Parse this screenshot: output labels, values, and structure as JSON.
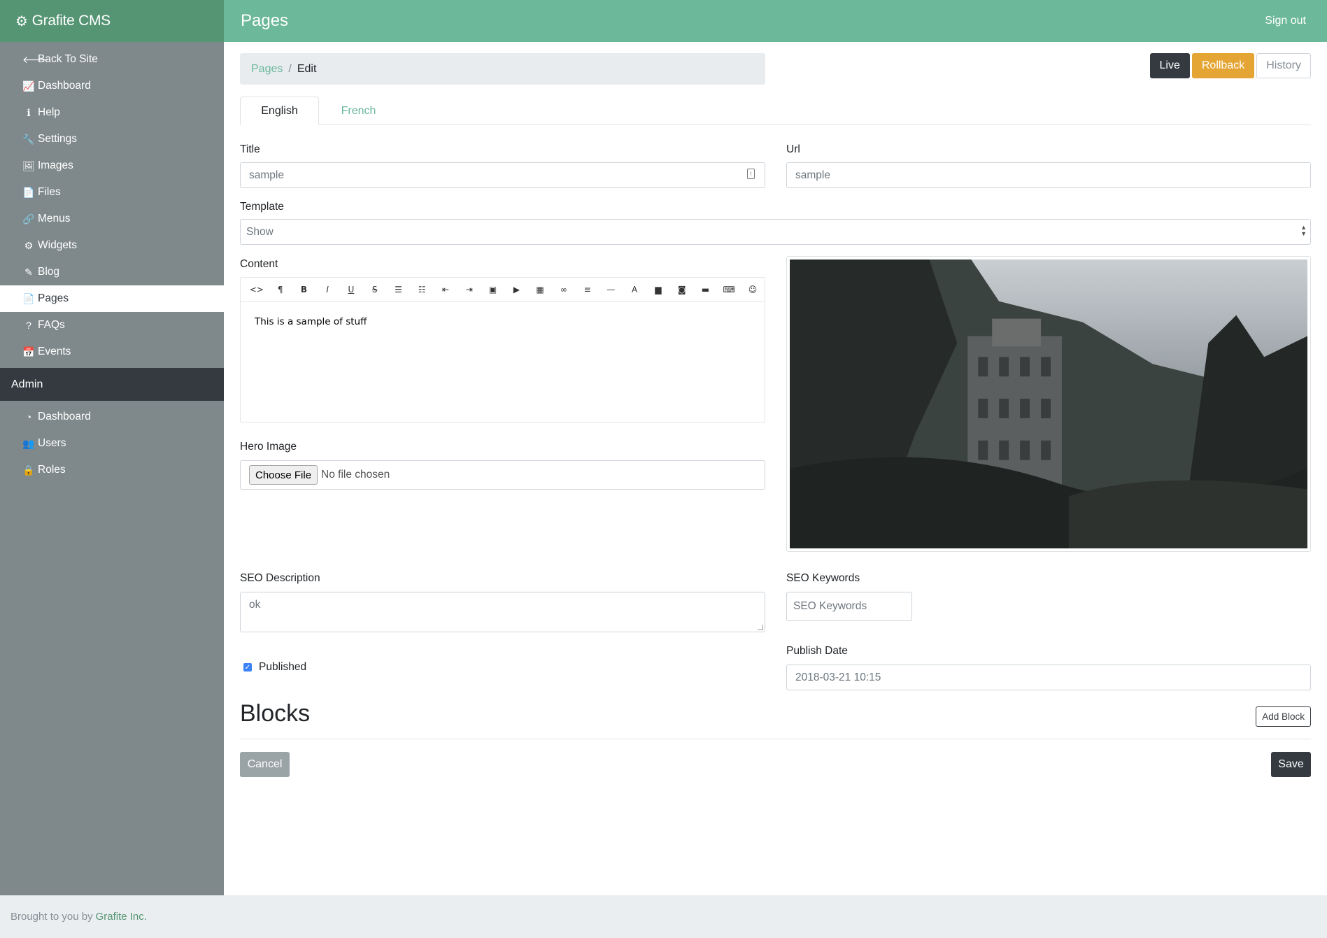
{
  "brand": {
    "name": "Grafite CMS",
    "icon": "cogs-icon"
  },
  "header": {
    "title": "Pages",
    "signout_label": "Sign out"
  },
  "sidebar": {
    "items": [
      {
        "label": "Back To Site",
        "icon": "arrow-left-icon",
        "glyph": "🡐"
      },
      {
        "label": "Dashboard",
        "icon": "line-chart-icon",
        "glyph": "📈"
      },
      {
        "label": "Help",
        "icon": "info-circle-icon",
        "glyph": "ℹ"
      },
      {
        "label": "Settings",
        "icon": "wrench-icon",
        "glyph": "🔧"
      },
      {
        "label": "Images",
        "icon": "image-icon",
        "glyph": "🖼"
      },
      {
        "label": "Files",
        "icon": "file-icon",
        "glyph": "📄"
      },
      {
        "label": "Menus",
        "icon": "link-icon",
        "glyph": "🔗"
      },
      {
        "label": "Widgets",
        "icon": "gear-icon",
        "glyph": "⚙"
      },
      {
        "label": "Blog",
        "icon": "pencil-icon",
        "glyph": "✎"
      },
      {
        "label": "Pages",
        "icon": "file-text-icon",
        "glyph": "📄",
        "active": true
      },
      {
        "label": "FAQs",
        "icon": "question-icon",
        "glyph": "?"
      },
      {
        "label": "Events",
        "icon": "calendar-icon",
        "glyph": "📅"
      }
    ],
    "admin_header": "Admin",
    "admin_items": [
      {
        "label": "Dashboard",
        "icon": "dashboard-icon",
        "glyph": "◔"
      },
      {
        "label": "Users",
        "icon": "users-icon",
        "glyph": "👥"
      },
      {
        "label": "Roles",
        "icon": "lock-icon",
        "glyph": "🔒"
      }
    ]
  },
  "breadcrumb": {
    "parent": "Pages",
    "separator": "/",
    "current": "Edit"
  },
  "actions": {
    "live": "Live",
    "rollback": "Rollback",
    "history": "History"
  },
  "tabs": [
    {
      "label": "English",
      "active": true
    },
    {
      "label": "French",
      "active": false
    }
  ],
  "form": {
    "title_label": "Title",
    "title_value": "sample",
    "url_label": "Url",
    "url_value": "sample",
    "template_label": "Template",
    "template_value": "Show",
    "content_label": "Content",
    "content_value": "This is a sample of stuff",
    "hero_label": "Hero Image",
    "choose_file": "Choose File",
    "no_file": "No file chosen",
    "seo_desc_label": "SEO Description",
    "seo_desc_value": "ok",
    "seo_keywords_label": "SEO Keywords",
    "seo_keywords_placeholder": "SEO Keywords",
    "published_label": "Published",
    "published": true,
    "publish_date_label": "Publish Date",
    "publish_date_value": "2018-03-21 10:15"
  },
  "editor_toolbar": [
    {
      "name": "code-icon",
      "glyph": "<>"
    },
    {
      "name": "paragraph-icon",
      "glyph": "¶"
    },
    {
      "name": "bold-icon",
      "glyph": "B"
    },
    {
      "name": "italic-icon",
      "glyph": "I"
    },
    {
      "name": "underline-icon",
      "glyph": "U"
    },
    {
      "name": "strikethrough-icon",
      "glyph": "S"
    },
    {
      "name": "unordered-list-icon",
      "glyph": "☰"
    },
    {
      "name": "ordered-list-icon",
      "glyph": "☷"
    },
    {
      "name": "outdent-icon",
      "glyph": "⇤"
    },
    {
      "name": "indent-icon",
      "glyph": "⇥"
    },
    {
      "name": "image-icon",
      "glyph": "▣"
    },
    {
      "name": "video-icon",
      "glyph": "▶"
    },
    {
      "name": "table-icon",
      "glyph": "▦"
    },
    {
      "name": "link-icon",
      "glyph": "∞"
    },
    {
      "name": "align-icon",
      "glyph": "≡"
    },
    {
      "name": "horizontal-rule-icon",
      "glyph": "—"
    },
    {
      "name": "font-color-icon",
      "glyph": "A"
    },
    {
      "name": "background-color-icon",
      "glyph": "▆"
    },
    {
      "name": "insert-photo-icon",
      "glyph": "◙"
    },
    {
      "name": "archive-icon",
      "glyph": "▬"
    },
    {
      "name": "keyboard-icon",
      "glyph": "⌨"
    },
    {
      "name": "emoji-icon",
      "glyph": "☺"
    }
  ],
  "blocks": {
    "title": "Blocks",
    "add_label": "Add Block"
  },
  "buttons": {
    "cancel": "Cancel",
    "save": "Save"
  },
  "footer": {
    "text": "Brought to you by",
    "link": "Grafite Inc."
  },
  "colors": {
    "brand": "#559573",
    "header": "#6bb89a",
    "sidebar": "#7f898b",
    "dark": "#343a40",
    "warning": "#e4a534"
  }
}
